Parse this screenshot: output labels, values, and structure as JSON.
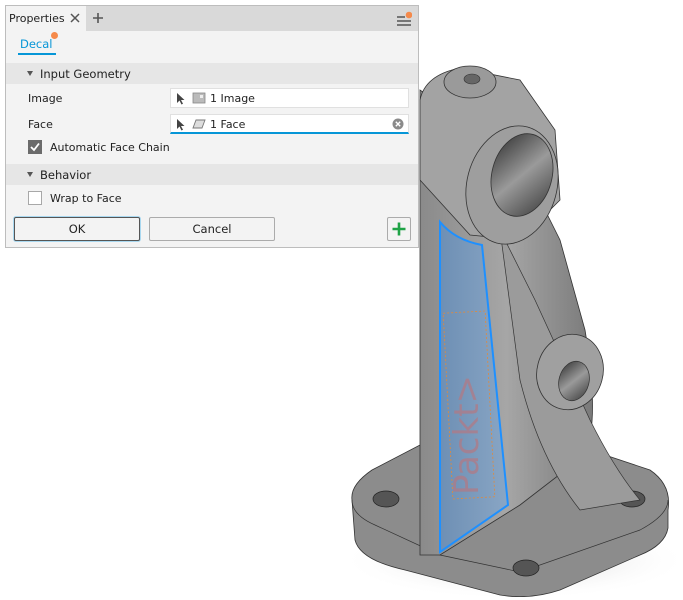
{
  "panel": {
    "tab_label": "Properties",
    "tab_close_icon": "close-icon",
    "tab_add_icon": "plus-icon",
    "menu_icon": "hamburger-menu-icon",
    "notification_color": "#f58a4b",
    "decal_tab_label": "Decal",
    "accent_color": "#0696d7"
  },
  "sections": {
    "input_geometry": {
      "title": "Input Geometry",
      "image_label": "Image",
      "image_value": "1 Image",
      "face_label": "Face",
      "face_value": "1 Face",
      "auto_face_chain_label": "Automatic Face Chain",
      "auto_face_chain_checked": true
    },
    "behavior": {
      "title": "Behavior",
      "wrap_to_face_label": "Wrap to Face",
      "wrap_to_face_checked": false
    }
  },
  "buttons": {
    "ok_label": "OK",
    "cancel_label": "Cancel",
    "add_icon": "green-plus-icon"
  },
  "viewport": {
    "model": "bracket-part",
    "decal_text": "Packt>",
    "selection_color": "#1e90ff"
  }
}
